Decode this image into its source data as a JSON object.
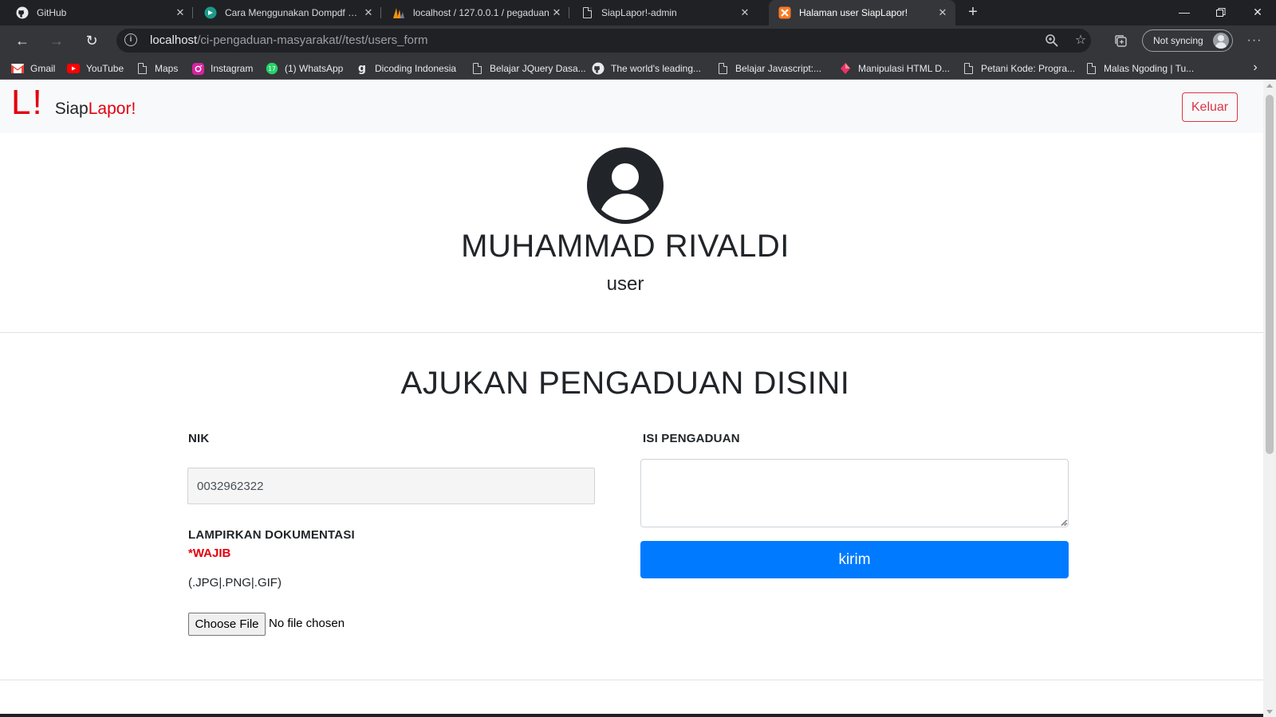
{
  "browser": {
    "tabs": [
      {
        "title": "GitHub",
        "icon": "github-icon"
      },
      {
        "title": "Cara Menggunakan Dompdf di C",
        "icon": "dompdf-icon"
      },
      {
        "title": "localhost / 127.0.0.1 / pegaduan",
        "icon": "phpmyadmin-icon"
      },
      {
        "title": "SiapLapor!-admin",
        "icon": "page-icon"
      },
      {
        "title": "Halaman user SiapLapor!",
        "icon": "xampp-icon"
      }
    ],
    "url_host": "localhost",
    "url_path": "/ci-pengaduan-masyarakat//test/users_form",
    "sync_label": "Not syncing",
    "bookmarks": [
      {
        "label": "Gmail",
        "icon": "gmail-icon"
      },
      {
        "label": "YouTube",
        "icon": "youtube-icon"
      },
      {
        "label": "Maps",
        "icon": "page-icon"
      },
      {
        "label": "Instagram",
        "icon": "instagram-icon"
      },
      {
        "label": "(1) WhatsApp",
        "icon": "whatsapp-icon"
      },
      {
        "label": "Dicoding Indonesia",
        "icon": "dicoding-icon"
      },
      {
        "label": "Belajar JQuery Dasa...",
        "icon": "page-icon"
      },
      {
        "label": "The world's leading...",
        "icon": "github-icon"
      },
      {
        "label": "Belajar Javascript:...",
        "icon": "page-icon"
      },
      {
        "label": "Manipulasi HTML D...",
        "icon": "diamond-icon"
      },
      {
        "label": "Petani Kode: Progra...",
        "icon": "page-icon"
      },
      {
        "label": "Malas Ngoding | Tu...",
        "icon": "page-icon"
      }
    ]
  },
  "navbar": {
    "logo": "L!",
    "brand_part1": "Siap",
    "brand_part2": "Lapor",
    "brand_part3": "!",
    "logout_label": "Keluar"
  },
  "profile": {
    "name": "MUHAMMAD RIVALDI",
    "role": "user"
  },
  "form": {
    "title": "AJUKAN PENGADUAN DISINI",
    "nik_label": "NIK",
    "nik_value": "0032962322",
    "attach_label": "LAMPIRKAN DOKUMENTASI",
    "required_label": "*WAJIB",
    "formats_hint": "(.JPG|.PNG|.GIF)",
    "file_button_label": "Choose File",
    "file_status": "No file chosen",
    "complaint_label": "ISI PENGADUAN",
    "complaint_value": "",
    "submit_label": "kirim"
  },
  "colors": {
    "brand_red": "#e3000f",
    "primary_blue": "#007bff",
    "danger": "#dc3545",
    "navbar_bg": "#f8f9fa"
  }
}
